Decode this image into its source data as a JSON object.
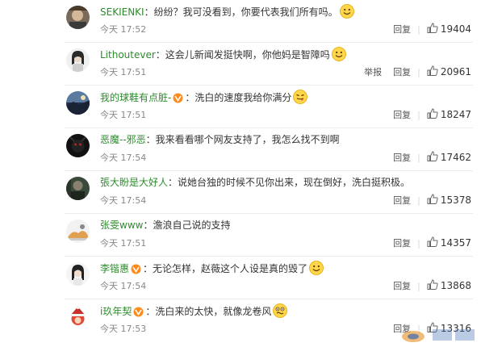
{
  "comments": [
    {
      "username": "SEKIENKI",
      "vip": false,
      "text": "：纷纷？我可没看到，你要代表我们所有吗。",
      "emoji": "smile-emoji",
      "time": "今天 17:52",
      "actions": [
        "回复"
      ],
      "likes": "19404"
    },
    {
      "username": "Lithoutever",
      "vip": false,
      "text": "：这会儿新闻发挺快啊，你他妈是智障吗",
      "emoji": "smile-emoji",
      "time": "今天 17:51",
      "actions": [
        "举报",
        "回复"
      ],
      "likes": "20961"
    },
    {
      "username": "我的球鞋有点脏-",
      "vip": true,
      "text": "：洗白的速度我给你满分",
      "emoji": "tongue-emoji",
      "time": "今天 17:51",
      "actions": [
        "回复"
      ],
      "likes": "18247"
    },
    {
      "username": "恶魔--邪恶",
      "vip": false,
      "text": "：我来看看哪个网友支持了，我怎么找不到啊",
      "emoji": "",
      "time": "今天 17:54",
      "actions": [
        "回复"
      ],
      "likes": "17462"
    },
    {
      "username": "張大盼是大好人",
      "vip": false,
      "text": "：说她台独的时候不见你出来，现在倒好，洗白挺积极。",
      "emoji": "",
      "time": "今天 17:54",
      "actions": [
        "回复"
      ],
      "likes": "15378"
    },
    {
      "username": "张雯www",
      "vip": false,
      "text": "：澹浪自己说的支持",
      "emoji": "",
      "time": "今天 17:51",
      "actions": [
        "回复"
      ],
      "likes": "14357"
    },
    {
      "username": "李锴惠",
      "vip": true,
      "text": "：无论怎样，赵薇这个人设是真的毁了",
      "emoji": "smile-emoji",
      "time": "今天 17:54",
      "actions": [
        "回复"
      ],
      "likes": "13868"
    },
    {
      "username": "i玖年契",
      "vip": true,
      "text": "：洗白来的太快，就像龙卷风",
      "emoji": "crazy-emoji",
      "time": "今天 17:53",
      "actions": [
        "回复"
      ],
      "likes": "13316"
    }
  ],
  "colors": {
    "username": "#2c8c2c",
    "text": "#333333",
    "meta": "#888888"
  }
}
